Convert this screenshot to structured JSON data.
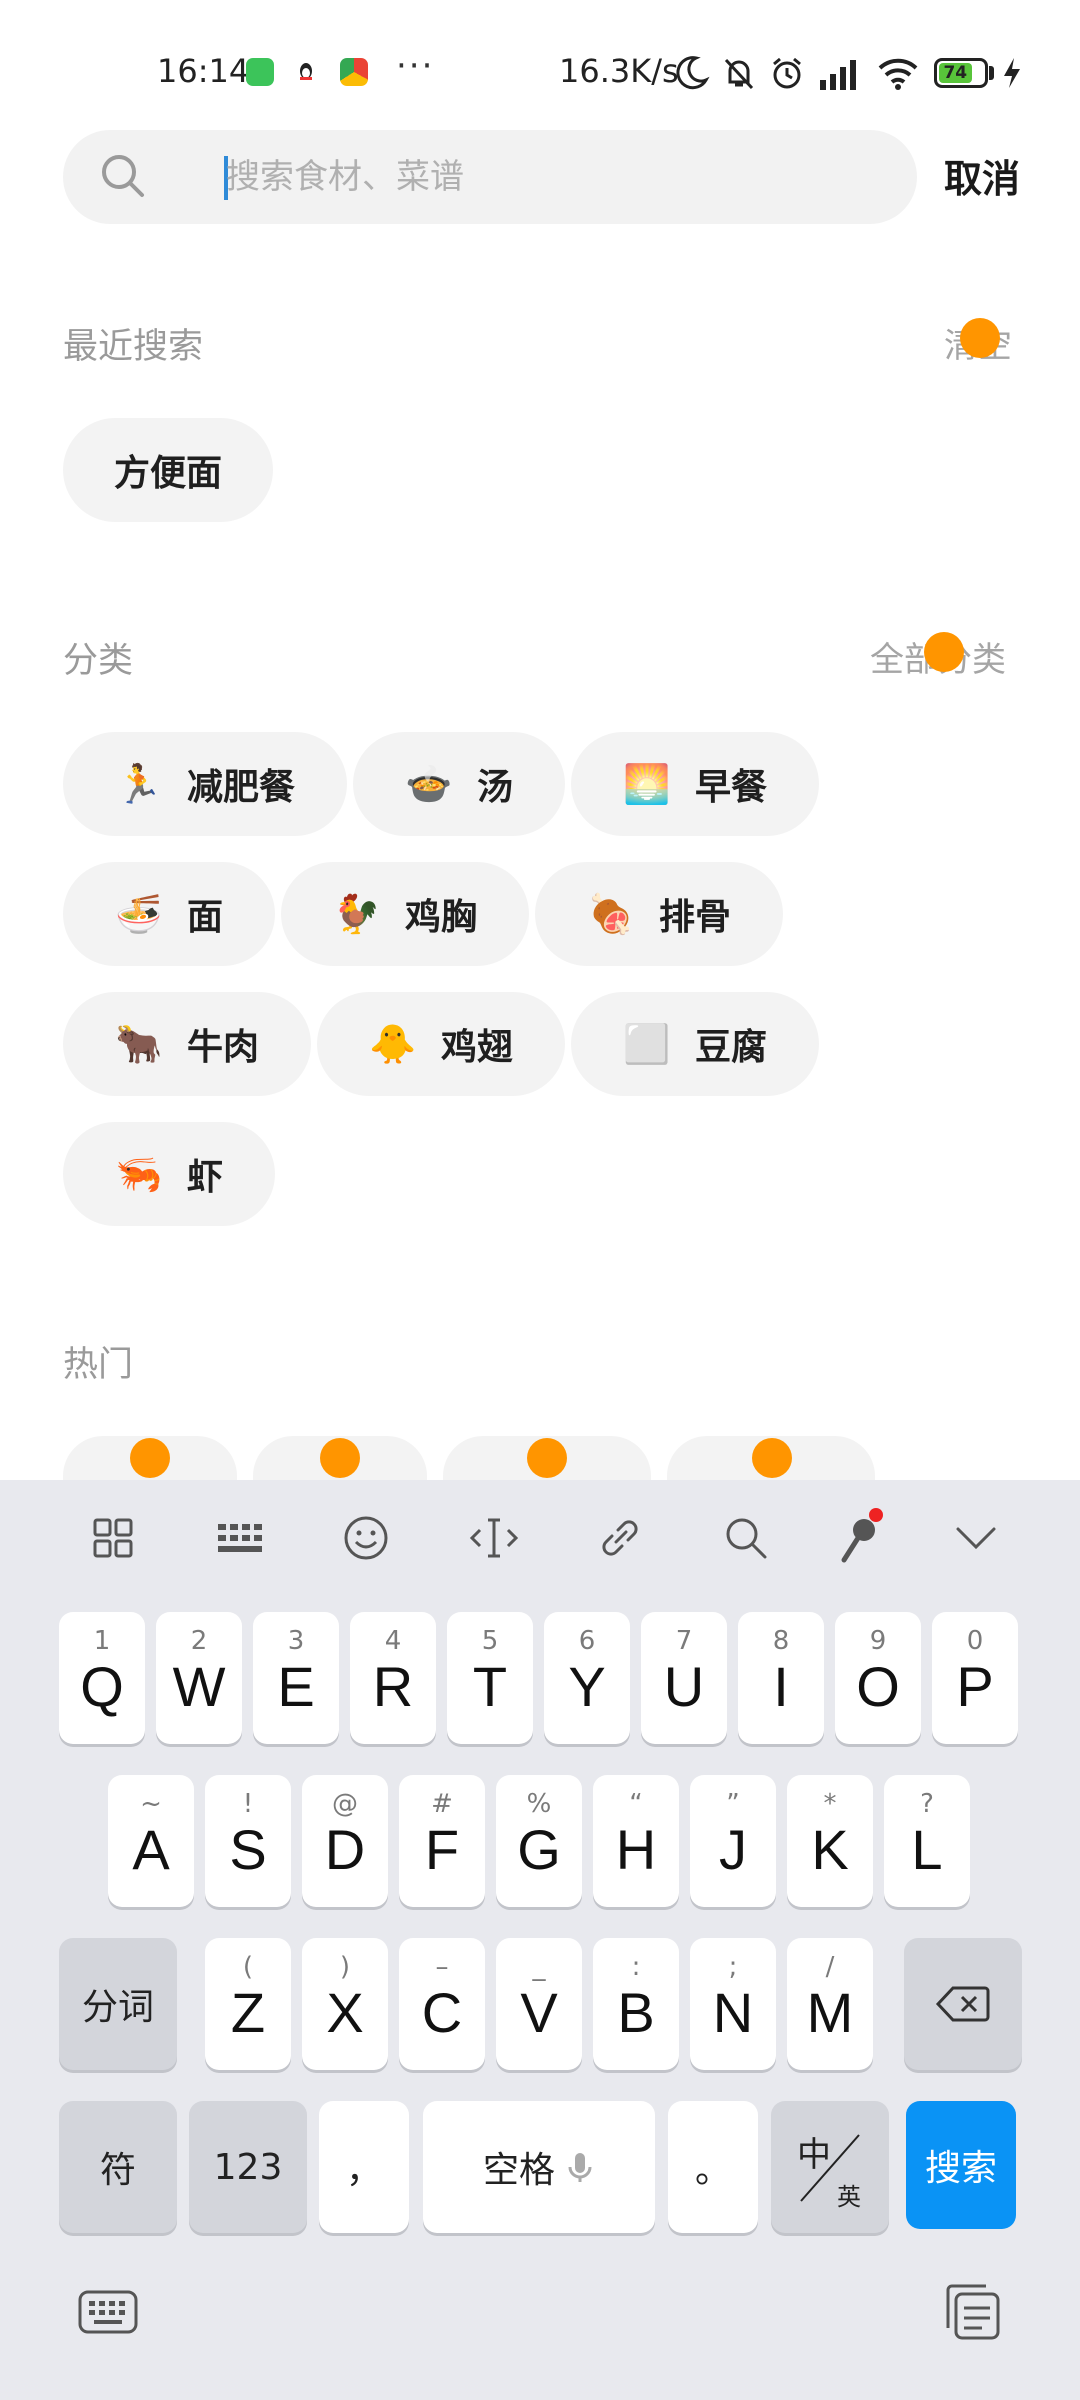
{
  "status_bar": {
    "time": "16:14",
    "more": "···",
    "net_speed": "16.3K/s",
    "battery": "74"
  },
  "search": {
    "placeholder": "搜索食材、菜谱",
    "value": "",
    "cancel_label": "取消"
  },
  "recent": {
    "title": "最近搜索",
    "clear_label": "清空",
    "items": [
      "方便面"
    ]
  },
  "category": {
    "title": "分类",
    "all_label": "全部分类",
    "items": [
      {
        "emoji": "🏃",
        "label": "减肥餐"
      },
      {
        "emoji": "🍲",
        "label": "汤"
      },
      {
        "emoji": "🌅",
        "label": "早餐"
      },
      {
        "emoji": "🍜",
        "label": "面"
      },
      {
        "emoji": "🐓",
        "label": "鸡胸"
      },
      {
        "emoji": "🍖",
        "label": "排骨"
      },
      {
        "emoji": "🐂",
        "label": "牛肉"
      },
      {
        "emoji": "🐥",
        "label": "鸡翅"
      },
      {
        "emoji": "⬜",
        "label": "豆腐"
      },
      {
        "emoji": "🦐",
        "label": "虾"
      }
    ]
  },
  "hot": {
    "title": "热门"
  },
  "keyboard": {
    "row1": [
      {
        "sub": "1",
        "main": "Q"
      },
      {
        "sub": "2",
        "main": "W"
      },
      {
        "sub": "3",
        "main": "E"
      },
      {
        "sub": "4",
        "main": "R"
      },
      {
        "sub": "5",
        "main": "T"
      },
      {
        "sub": "6",
        "main": "Y"
      },
      {
        "sub": "7",
        "main": "U"
      },
      {
        "sub": "8",
        "main": "I"
      },
      {
        "sub": "9",
        "main": "O"
      },
      {
        "sub": "0",
        "main": "P"
      }
    ],
    "row2": [
      {
        "sub": "~",
        "main": "A"
      },
      {
        "sub": "!",
        "main": "S"
      },
      {
        "sub": "@",
        "main": "D"
      },
      {
        "sub": "#",
        "main": "F"
      },
      {
        "sub": "%",
        "main": "G"
      },
      {
        "sub": "“",
        "main": "H"
      },
      {
        "sub": "”",
        "main": "J"
      },
      {
        "sub": "*",
        "main": "K"
      },
      {
        "sub": "?",
        "main": "L"
      }
    ],
    "row3": [
      {
        "sub": "(",
        "main": "Z"
      },
      {
        "sub": ")",
        "main": "X"
      },
      {
        "sub": "–",
        "main": "C"
      },
      {
        "sub": "_",
        "main": "V"
      },
      {
        "sub": ":",
        "main": "B"
      },
      {
        "sub": ";",
        "main": "N"
      },
      {
        "sub": "/",
        "main": "M"
      }
    ],
    "fenci_label": "分词",
    "symbol_label": "符",
    "num_label": "123",
    "comma_label": "，",
    "space_label": "空格",
    "period_label": "。",
    "lang_top": "中",
    "lang_bottom": "英",
    "search_label": "搜索"
  }
}
